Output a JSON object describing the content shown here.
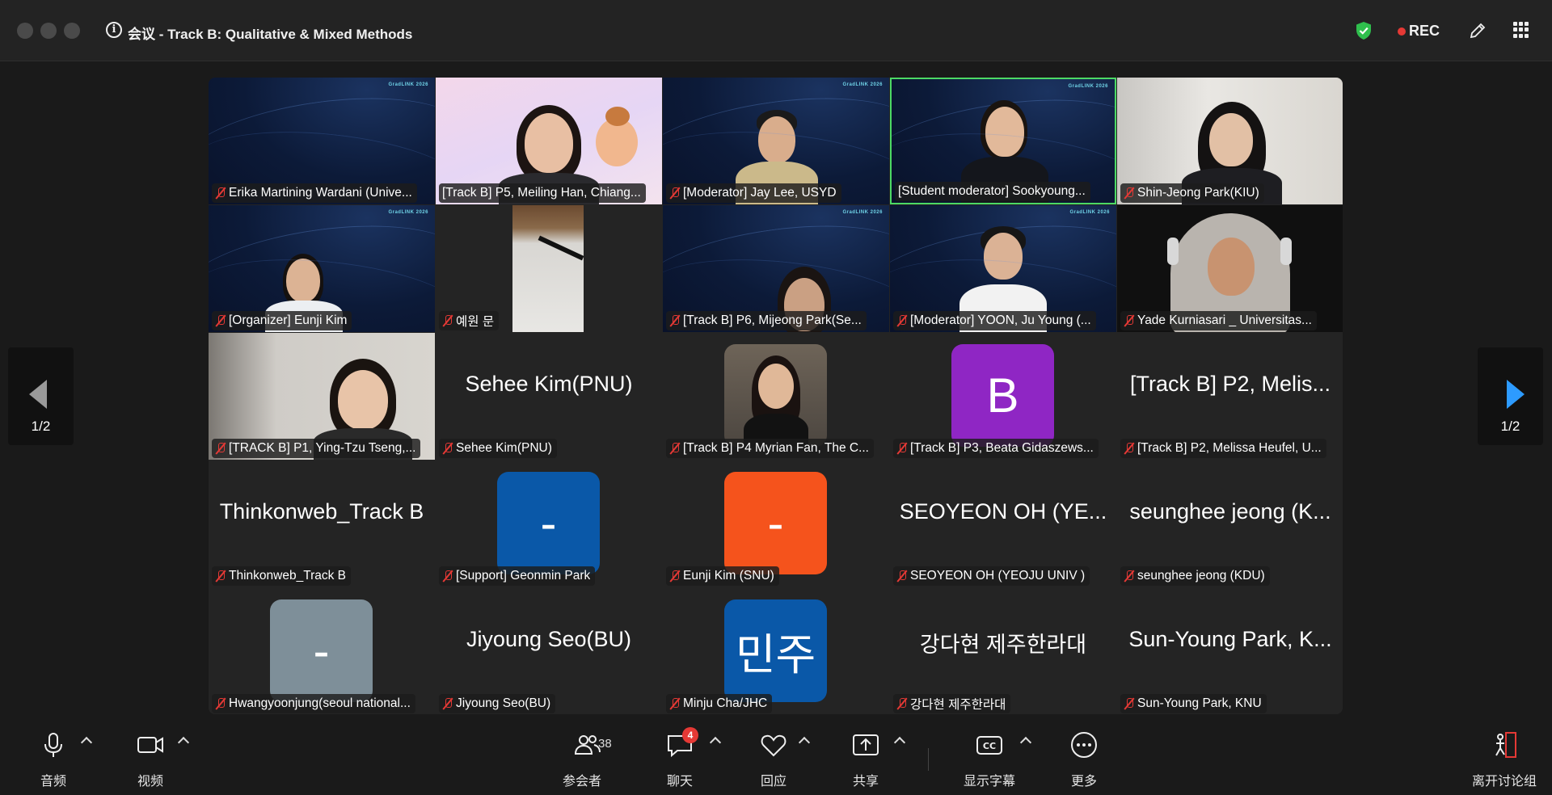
{
  "window": {
    "title": "会议 - Track B: Qualitative & Mixed Methods",
    "rec_label": "REC"
  },
  "gallery": {
    "page_indicator": "1/2",
    "tiles": [
      {
        "name": "Erika Martining Wardani (Unive...",
        "center": ""
      },
      {
        "name": "[Track B] P5, Meiling Han, Chiang...",
        "center": ""
      },
      {
        "name": "[Moderator] Jay Lee, USYD",
        "center": ""
      },
      {
        "name": "[Student moderator] Sookyoung...",
        "center": ""
      },
      {
        "name": "Shin-Jeong Park(KIU)",
        "center": ""
      },
      {
        "name": "[Organizer] Eunji Kim",
        "center": ""
      },
      {
        "name": "예원 문",
        "center": ""
      },
      {
        "name": "[Track B] P6, Mijeong Park(Se...",
        "center": ""
      },
      {
        "name": "[Moderator] YOON, Ju Young (...",
        "center": ""
      },
      {
        "name": "Yade Kurniasari _ Universitas...",
        "center": ""
      },
      {
        "name": "[TRACK B] P1, Ying-Tzu Tseng,...",
        "center": ""
      },
      {
        "name": "Sehee Kim(PNU)",
        "center": "Sehee Kim(PNU)"
      },
      {
        "name": "[Track B] P4 Myrian Fan, The C...",
        "center": ""
      },
      {
        "name": "[Track B] P3, Beata Gidaszews...",
        "center": "B"
      },
      {
        "name": "[Track B] P2, Melissa Heufel, U...",
        "center": "[Track B] P2, Melis..."
      },
      {
        "name": "Thinkonweb_Track B",
        "center": "Thinkonweb_Track B"
      },
      {
        "name": "[Support] Geonmin Park",
        "center": "-"
      },
      {
        "name": "Eunji Kim (SNU)",
        "center": "-"
      },
      {
        "name": "SEOYEON OH (YEOJU UNIV )",
        "center": "SEOYEON OH (YE..."
      },
      {
        "name": "seunghee jeong (KDU)",
        "center": "seunghee jeong (K..."
      },
      {
        "name": "Hwangyoonjung(seoul national...",
        "center": "-"
      },
      {
        "name": "Jiyoung Seo(BU)",
        "center": "Jiyoung Seo(BU)"
      },
      {
        "name": "Minju Cha/JHC",
        "center": "민주"
      },
      {
        "name": "강다현 제주한라대",
        "center": "강다현 제주한라대"
      },
      {
        "name": "Sun-Young Park, KNU",
        "center": "Sun-Young Park, K..."
      }
    ],
    "brand_text": "GradLINK 2026"
  },
  "toolbar": {
    "audio": "音频",
    "video": "视频",
    "participants": "参会者",
    "participants_count": "38",
    "chat": "聊天",
    "chat_badge": "4",
    "reactions": "回应",
    "share": "共享",
    "captions": "显示字幕",
    "more": "更多",
    "leave": "离开讨论组"
  },
  "colors": {
    "active_speaker_border": "#4cd964",
    "mute_red": "#e53935",
    "avatar_purple": "#8f26c4",
    "avatar_blue": "#0a58a8",
    "avatar_orange": "#f5531c",
    "avatar_gray": "#7e8f99",
    "next_arrow": "#2d9bff"
  }
}
